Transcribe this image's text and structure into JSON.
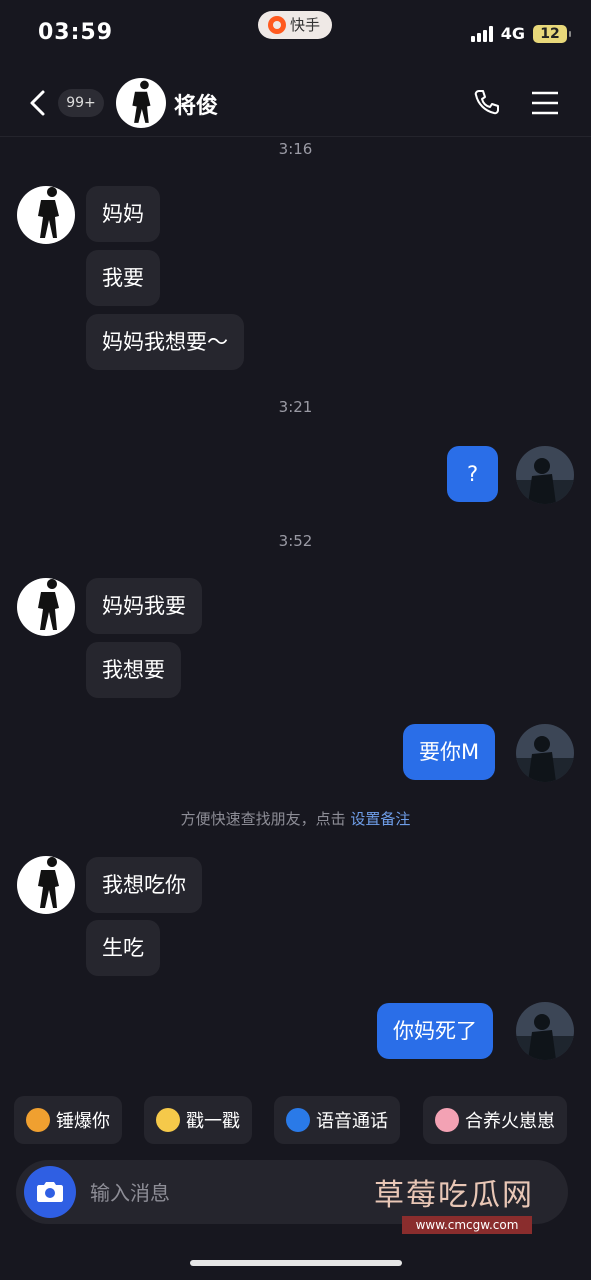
{
  "status_bar": {
    "time": "03:59",
    "app_name": "快手",
    "network": "4G",
    "battery": "12"
  },
  "header": {
    "unread_badge": "99+",
    "contact_name": "将俊"
  },
  "messages": {
    "t1": "3:16",
    "m1": "妈妈",
    "m2": "我要",
    "m3": "妈妈我想要～",
    "t2": "3:21",
    "m4": "?",
    "t3": "3:52",
    "m5": "妈妈我要",
    "m6": "我想要",
    "m7": "要你M",
    "system_text": "方便快速查找朋友，点击",
    "system_link": "设置备注",
    "m8": "我想吃你",
    "m9": "生吃",
    "m10": "你妈死了"
  },
  "quick_actions": [
    "锤爆你",
    "戳一戳",
    "语音通话",
    "合养火崽崽"
  ],
  "input": {
    "placeholder": "输入消息"
  },
  "watermark": {
    "text": "草莓吃瓜网",
    "url": "www.cmcgw.com"
  },
  "colors": {
    "background": "#17171f",
    "outgoing_bubble": "#2a6ee8",
    "incoming_bubble": "#26262e",
    "link": "#6f9ee8"
  }
}
